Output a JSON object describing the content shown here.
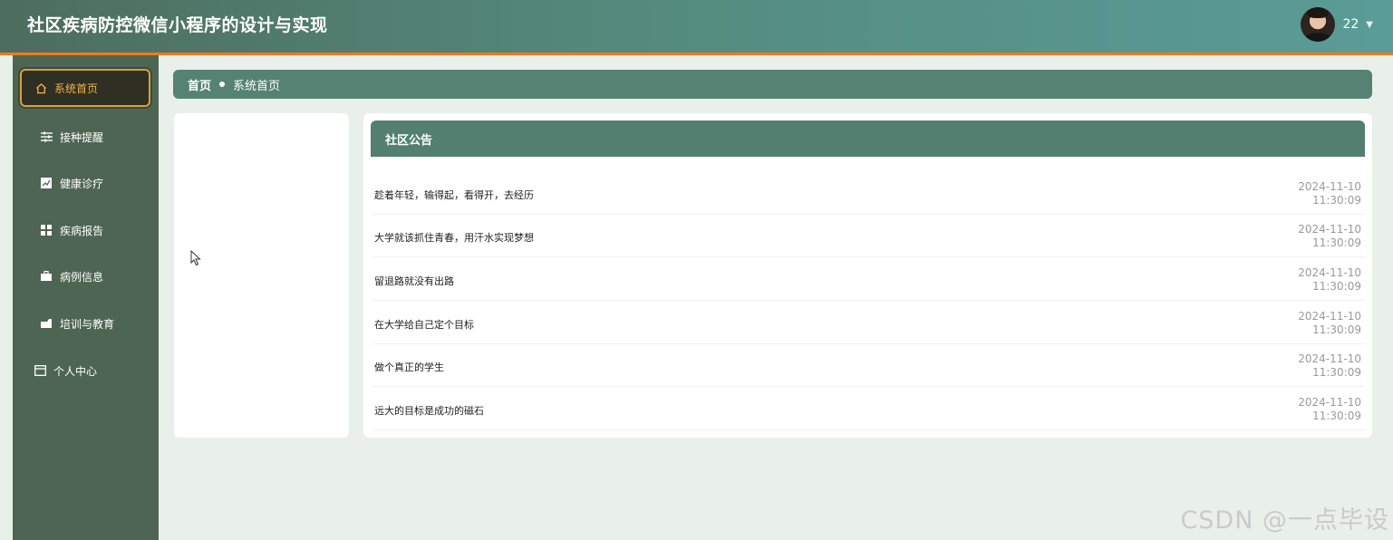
{
  "header": {
    "title": "社区疾病防控微信小程序的设计与实现",
    "user_name": "22",
    "caret": "▼"
  },
  "sidebar": {
    "items": [
      {
        "label": "系统首页",
        "icon": "home-icon",
        "active": true
      },
      {
        "label": "接种提醒",
        "icon": "sliders-icon"
      },
      {
        "label": "健康诊疗",
        "icon": "chart-icon"
      },
      {
        "label": "疾病报告",
        "icon": "grid-icon"
      },
      {
        "label": "病例信息",
        "icon": "briefcase-icon"
      },
      {
        "label": "培训与教育",
        "icon": "bookmark-icon"
      },
      {
        "label": "个人中心",
        "icon": "card-icon"
      }
    ]
  },
  "breadcrumb": {
    "home": "首页",
    "current": "系统首页"
  },
  "notice": {
    "title": "社区公告",
    "items": [
      {
        "title": "趁着年轻，输得起，看得开，去经历",
        "date": "2024-11-10",
        "time": "11:30:09"
      },
      {
        "title": "大学就该抓住青春，用汗水实现梦想",
        "date": "2024-11-10",
        "time": "11:30:09"
      },
      {
        "title": "留退路就没有出路",
        "date": "2024-11-10",
        "time": "11:30:09"
      },
      {
        "title": "在大学给自己定个目标",
        "date": "2024-11-10",
        "time": "11:30:09"
      },
      {
        "title": "做个真正的学生",
        "date": "2024-11-10",
        "time": "11:30:09"
      },
      {
        "title": "远大的目标是成功的磁石",
        "date": "2024-11-10",
        "time": "11:30:09"
      }
    ]
  },
  "watermark": "CSDN @一点毕设",
  "colors": {
    "header_start": "#4d6d5e",
    "header_end": "#5a9c98",
    "accent_orange": "#f07a1c",
    "sidebar_bg": "#4e6554",
    "active_text": "#f3b247"
  }
}
